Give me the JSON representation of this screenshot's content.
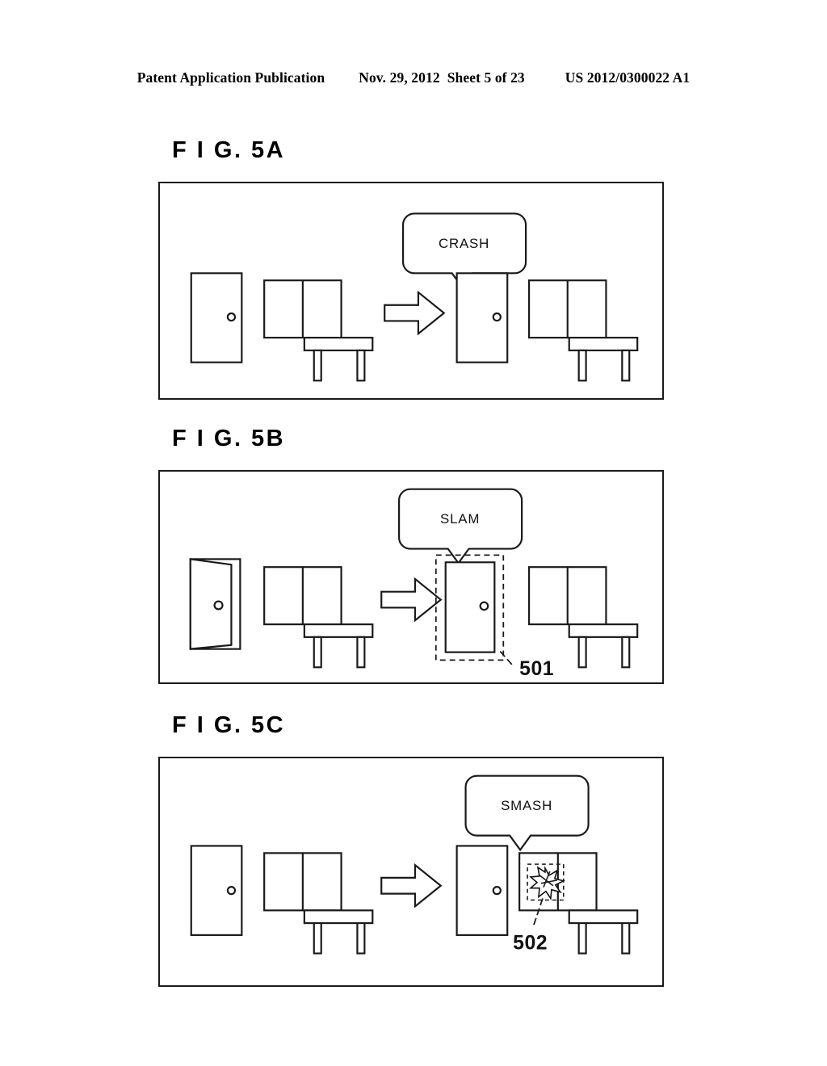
{
  "header": {
    "publication": "Patent Application Publication",
    "date": "Nov. 29, 2012",
    "sheet": "Sheet 5 of 23",
    "patent_number": "US 2012/0300022 A1"
  },
  "figures": [
    {
      "id": "fig-a",
      "label": "F I G.  5A",
      "bubble": "CRASH",
      "left_scene": {
        "door": "closed-door",
        "window": "two-pane-window",
        "table": "table"
      },
      "arrow": "right-arrow",
      "right_scene": {
        "door": "closed-door",
        "window": "two-pane-window",
        "table": "table"
      },
      "annotations": []
    },
    {
      "id": "fig-b",
      "label": "F I G.  5B",
      "bubble": "SLAM",
      "left_scene": {
        "door": "open-door",
        "window": "two-pane-window",
        "table": "table"
      },
      "arrow": "right-arrow",
      "right_scene": {
        "door": "closed-door-highlighted",
        "window": "two-pane-window",
        "table": "table"
      },
      "annotations": [
        {
          "ref": "501",
          "target": "door-selection-box"
        }
      ]
    },
    {
      "id": "fig-c",
      "label": "F I G.  5C",
      "bubble": "SMASH",
      "left_scene": {
        "door": "closed-door",
        "window": "two-pane-window",
        "table": "table"
      },
      "arrow": "right-arrow",
      "right_scene": {
        "door": "closed-door",
        "window": "two-pane-window-shattered",
        "table": "table"
      },
      "annotations": [
        {
          "ref": "502",
          "target": "window-break-selection-box"
        }
      ]
    }
  ],
  "colors": {
    "ink": "#1a1a1a",
    "paper": "#ffffff"
  }
}
